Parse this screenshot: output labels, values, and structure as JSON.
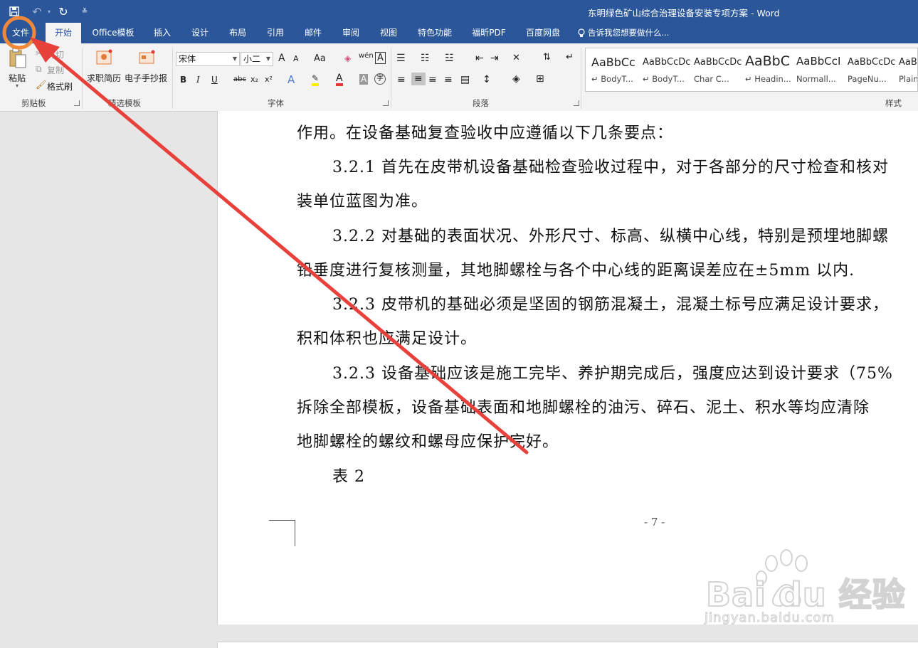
{
  "titlebar": {
    "qat": {
      "save_icon": "save-icon",
      "undo_icon": "undo-icon",
      "redo_icon": "redo-icon",
      "customize_icon": "customize-qat-icon"
    },
    "title": "东明绿色矿山综合治理设备安装专项方案 - Word"
  },
  "tabs": [
    {
      "label": "文件"
    },
    {
      "label": "开始"
    },
    {
      "label": "Office模板"
    },
    {
      "label": "插入"
    },
    {
      "label": "设计"
    },
    {
      "label": "布局"
    },
    {
      "label": "引用"
    },
    {
      "label": "邮件"
    },
    {
      "label": "审阅"
    },
    {
      "label": "视图"
    },
    {
      "label": "特色功能"
    },
    {
      "label": "福昕PDF"
    },
    {
      "label": "百度网盘"
    }
  ],
  "tell_me": "告诉我您想要做什么...",
  "ribbon": {
    "clipboard": {
      "paste": "粘贴",
      "cut": "剪切",
      "copy": "复制",
      "format_painter": "格式刷",
      "group": "剪贴板"
    },
    "templates": {
      "resume": "求职简历",
      "newspaper": "电子手抄报",
      "group": "精选模板"
    },
    "font": {
      "name": "宋体",
      "size": "小二",
      "group": "字体",
      "grow": "A",
      "shrink": "A",
      "case": "Aa",
      "phonetic": "wén",
      "border_char": "A",
      "bold": "B",
      "italic": "I",
      "underline": "U",
      "strike": "abc",
      "subscript": "x₂",
      "superscript": "x²",
      "text_effect": "A",
      "font_color": "A",
      "char_shading": "A",
      "enclose": "字"
    },
    "paragraph": {
      "group": "段落"
    },
    "styles": {
      "group": "样式",
      "items": [
        {
          "sample": "AaBbCc",
          "name": "↵ BodyT..."
        },
        {
          "sample": "AaBbCcDc",
          "name": "↵ BodyT..."
        },
        {
          "sample": "AaBbCcDc",
          "name": "Char C..."
        },
        {
          "sample": "AaBbC",
          "name": "↵ Headin..."
        },
        {
          "sample": "AaBbCcI",
          "name": "Normall..."
        },
        {
          "sample": "AaBbCcDc",
          "name": "PageNu..."
        },
        {
          "sample": "AaBbCcDc",
          "name": "Plain"
        }
      ]
    }
  },
  "document": {
    "lines": [
      "作用。在设备基础复查验收中应遵循以下几条要点：",
      "3.2.1  首先在皮带机设备基础检查验收过程中，对于各部分的尺寸检查和核对",
      "装单位蓝图为准。",
      "3.2.2  对基础的表面状况、外形尺寸、标高、纵横中心线，特别是预埋地脚螺",
      "铅垂度进行复核测量，其地脚螺栓与各个中心线的距离误差应在±5mm 以内.",
      "3.2.3  皮带机的基础必须是坚固的钢筋混凝土，混凝土标号应满足设计要求，",
      "积和体积也应满足设计。",
      "3.2.3  设备基础应该是施工完毕、养护期完成后，强度应达到设计要求（75%",
      "拆除全部模板，设备基础表面和地脚螺栓的油污、碎石、泥土、积水等均应清除",
      "地脚螺栓的螺纹和螺母应保护完好。",
      "表 2"
    ],
    "page_number": "- 7 -"
  },
  "watermark": {
    "brand": "Bai du 经验",
    "url": "jingyan.baidu.com"
  },
  "annotation": {
    "circle_color": "#f0883a",
    "arrow_color": "#e8403a"
  }
}
